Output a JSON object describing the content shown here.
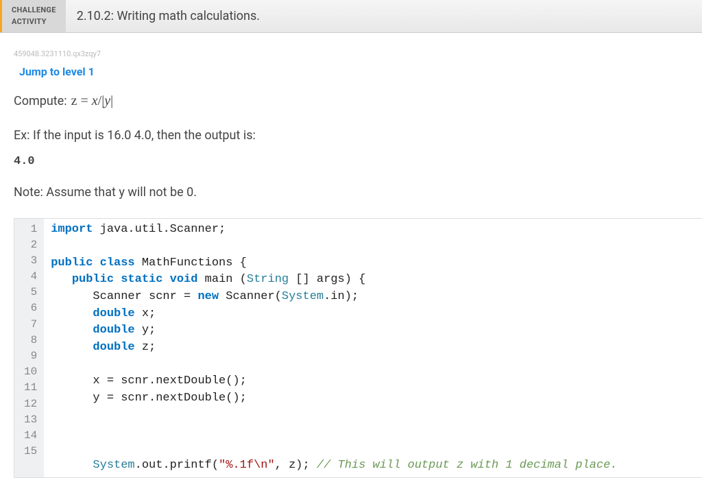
{
  "header": {
    "badge_line1": "CHALLENGE",
    "badge_line2": "ACTIVITY",
    "title": "2.10.2: Writing math calculations."
  },
  "meta": {
    "hash": "459048.3231110.qx3zqy7",
    "jump_label": "Jump to level 1"
  },
  "prompt": {
    "compute_prefix": "Compute:",
    "formula_z": "z",
    "formula_eq": "=",
    "formula_x": "x",
    "formula_slash": "/",
    "formula_y": "y",
    "example_text": "Ex: If the input is 16.0 4.0, then the output is:",
    "example_output": "4.0",
    "note_text": "Note: Assume that y will not be 0."
  },
  "code": {
    "lines": [
      {
        "n": 1,
        "tokens": [
          [
            "kw",
            "import"
          ],
          [
            "",
            " java.util.Scanner;"
          ]
        ]
      },
      {
        "n": 2,
        "tokens": [
          [
            "",
            ""
          ]
        ]
      },
      {
        "n": 3,
        "tokens": [
          [
            "kw",
            "public"
          ],
          [
            "",
            " "
          ],
          [
            "kw",
            "class"
          ],
          [
            "",
            " MathFunctions {"
          ]
        ]
      },
      {
        "n": 4,
        "tokens": [
          [
            "",
            "   "
          ],
          [
            "kw",
            "public"
          ],
          [
            "",
            " "
          ],
          [
            "kw",
            "static"
          ],
          [
            "",
            " "
          ],
          [
            "kw",
            "void"
          ],
          [
            "",
            " main ("
          ],
          [
            "cls",
            "String"
          ],
          [
            "",
            " [] args) {"
          ]
        ]
      },
      {
        "n": 5,
        "tokens": [
          [
            "",
            "      Scanner scnr = "
          ],
          [
            "kw",
            "new"
          ],
          [
            "",
            " Scanner("
          ],
          [
            "cls",
            "System"
          ],
          [
            "",
            ".in);"
          ]
        ]
      },
      {
        "n": 6,
        "tokens": [
          [
            "",
            "      "
          ],
          [
            "kw",
            "double"
          ],
          [
            "",
            " x;"
          ]
        ]
      },
      {
        "n": 7,
        "tokens": [
          [
            "",
            "      "
          ],
          [
            "kw",
            "double"
          ],
          [
            "",
            " y;"
          ]
        ]
      },
      {
        "n": 8,
        "tokens": [
          [
            "",
            "      "
          ],
          [
            "kw",
            "double"
          ],
          [
            "",
            " z;"
          ]
        ]
      },
      {
        "n": 9,
        "tokens": [
          [
            "",
            ""
          ]
        ]
      },
      {
        "n": 10,
        "tokens": [
          [
            "",
            "      x = scnr.nextDouble();"
          ]
        ]
      },
      {
        "n": 11,
        "tokens": [
          [
            "",
            "      y = scnr.nextDouble();"
          ]
        ]
      },
      {
        "n": 12,
        "tokens": [
          [
            "",
            ""
          ]
        ]
      },
      {
        "n": 13,
        "tokens": [
          [
            "",
            ""
          ]
        ]
      },
      {
        "n": 14,
        "tokens": [
          [
            "",
            ""
          ]
        ]
      },
      {
        "n": 15,
        "tokens": [
          [
            "",
            "      "
          ],
          [
            "cls",
            "System"
          ],
          [
            "",
            ".out.printf("
          ],
          [
            "str",
            "\"%.1f\\n\""
          ],
          [
            "",
            ", z); "
          ],
          [
            "com",
            "// This will output z with 1 decimal place."
          ]
        ]
      }
    ]
  }
}
